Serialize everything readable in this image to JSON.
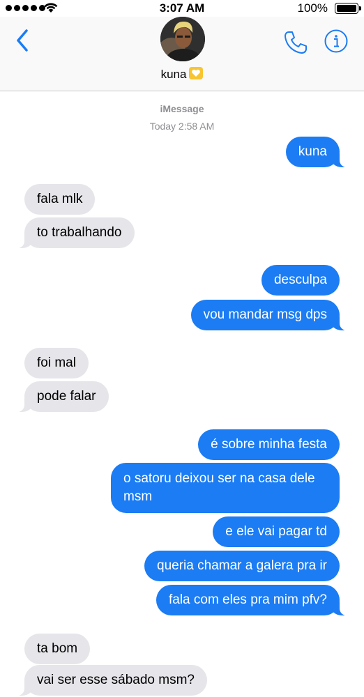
{
  "status_bar": {
    "time": "3:07 AM",
    "battery": "100%",
    "battery_level": 1.0,
    "signal_bars": 5
  },
  "header": {
    "contact_name": "kuna",
    "name_emoji": "yellow-heart",
    "icons": [
      "chevron-left-icon",
      "phone-icon",
      "info-icon"
    ],
    "accent_color": "#1b7cf4"
  },
  "thread": {
    "service": "iMessage",
    "timestamp": "Today 2:58 AM",
    "messages": [
      {
        "from": "me",
        "text": "kuna"
      },
      {
        "from": "them",
        "text": "fala mlk"
      },
      {
        "from": "them",
        "text": "to trabalhando"
      },
      {
        "from": "me",
        "text": "desculpa"
      },
      {
        "from": "me",
        "text": "vou mandar msg dps"
      },
      {
        "from": "them",
        "text": "foi mal"
      },
      {
        "from": "them",
        "text": "pode falar"
      },
      {
        "from": "me",
        "text": "é sobre minha festa"
      },
      {
        "from": "me",
        "text": "o satoru deixou ser na casa dele msm"
      },
      {
        "from": "me",
        "text": "e ele vai pagar td"
      },
      {
        "from": "me",
        "text": "queria chamar a galera pra ir"
      },
      {
        "from": "me",
        "text": "fala com eles pra mim pfv?"
      },
      {
        "from": "them",
        "text": "ta bom"
      },
      {
        "from": "them",
        "text": "vai ser esse sábado msm?"
      }
    ]
  },
  "colors": {
    "sent_bubble": "#1b7cf4",
    "received_bubble": "#e5e5ea",
    "meta_text": "#8e8e93"
  }
}
